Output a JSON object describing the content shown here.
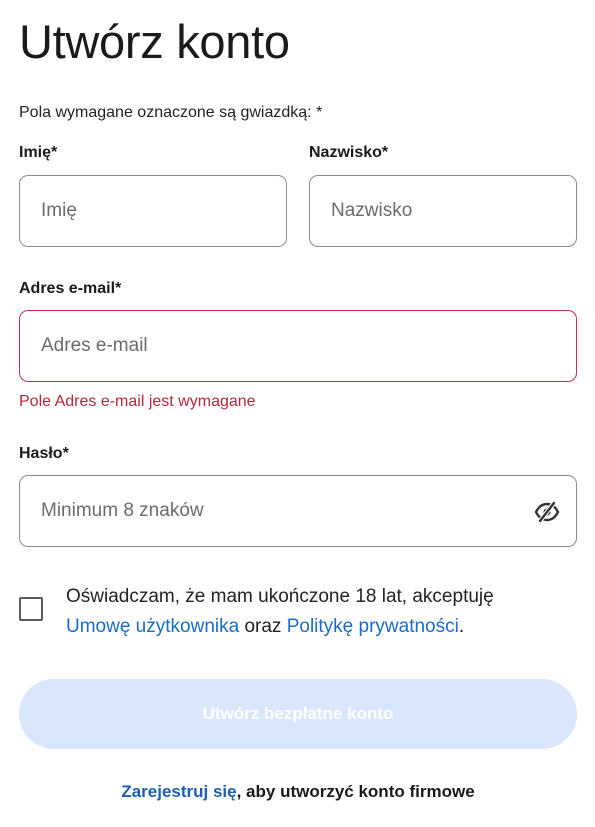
{
  "page": {
    "title": "Utwórz konto",
    "required_note": "Pola wymagane oznaczone są gwiazdką: *"
  },
  "form": {
    "first_name": {
      "label": "Imię*",
      "placeholder": "Imię",
      "value": ""
    },
    "last_name": {
      "label": "Nazwisko*",
      "placeholder": "Nazwisko",
      "value": ""
    },
    "email": {
      "label": "Adres e-mail*",
      "placeholder": "Adres e-mail",
      "value": "",
      "error": "Pole Adres e-mail jest wymagane"
    },
    "password": {
      "label": "Hasło*",
      "placeholder": "Minimum 8 znaków",
      "value": "",
      "toggle_icon": "eye-off-icon"
    },
    "consent": {
      "checked": false,
      "text_before": "Oświadczam, że mam ukończone 18 lat, akceptuję",
      "link_terms": "Umowę użytkownika",
      "text_middle": "oraz",
      "link_privacy": "Politykę prywatności",
      "text_end": "."
    },
    "submit_label": "Utwórz bezpłatne konto"
  },
  "footer": {
    "link_label": "Zarejestruj się",
    "text": ", aby utworzyć konto firmowe"
  },
  "colors": {
    "error": "#c4314b",
    "link": "#1a6cc7",
    "button_disabled_bg": "#d9e6fc"
  }
}
